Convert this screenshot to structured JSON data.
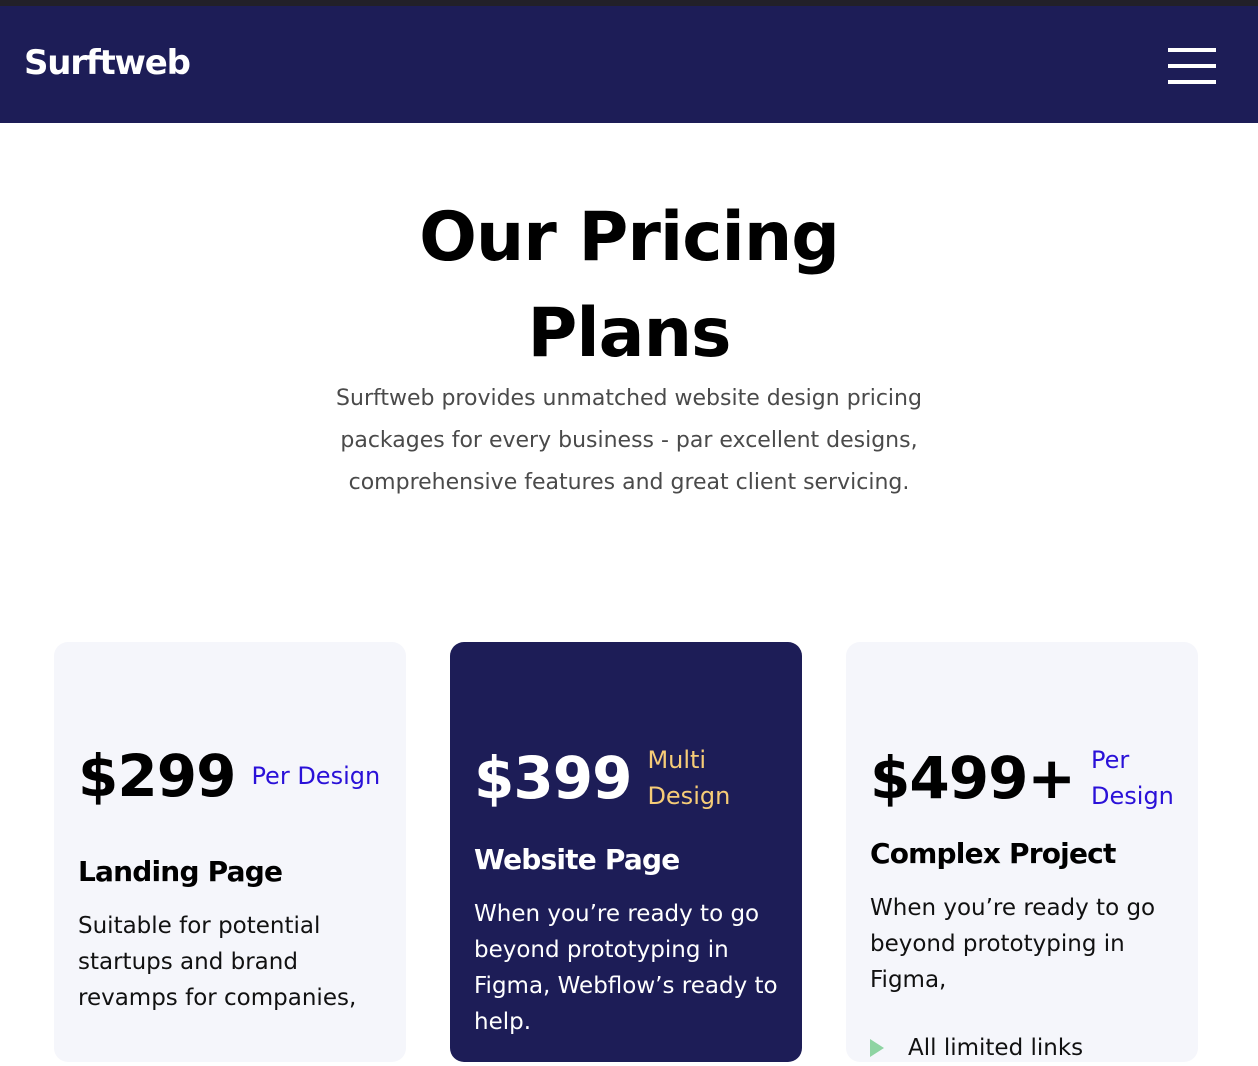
{
  "navbar": {
    "brand": "Surftweb",
    "menu_icon": "hamburger-menu-icon"
  },
  "hero": {
    "title": "Our Pricing Plans",
    "subtitle": "Surftweb provides unmatched website design pricing packages for every business - par excellent designs, comprehensive features and great client servicing."
  },
  "plans": [
    {
      "price": "$299",
      "unit": "Per Design",
      "name": "Landing Page",
      "description": "Suitable for potential startups and brand revamps for companies,"
    },
    {
      "price": "$399",
      "unit": "Multi Design",
      "name": "Website Page",
      "description": "When you’re ready to go beyond prototyping in Figma, Webflow’s ready to help."
    },
    {
      "price": "$499+",
      "unit": "Per Design",
      "name": "Complex Project",
      "description": "When you’re ready to go beyond prototyping in Figma,",
      "features": [
        "All limited links"
      ]
    }
  ],
  "colors": {
    "navbar_bg": "#1d1d57",
    "featured_card_bg": "#1d1d57",
    "card_bg": "#f5f6fb",
    "unit_text": "#2a11d8",
    "featured_unit_text": "#f6cc77",
    "feature_check": "#8ed4a2"
  }
}
